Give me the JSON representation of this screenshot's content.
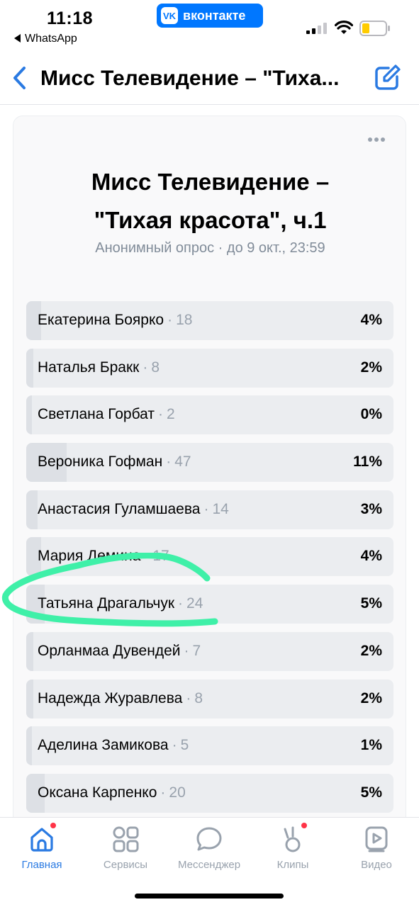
{
  "status_bar": {
    "time": "11:18",
    "back_app": "WhatsApp",
    "vk_logo": "VK",
    "vk_label": "вконтакте"
  },
  "header": {
    "title": "Мисс Телевидение – \"Тиха..."
  },
  "poll": {
    "title_line1": "Мисс Телевидение –",
    "title_line2": "\"Тихая красота\", ч.1",
    "subtitle": "Анонимный опрос · до 9 окт., 23:59",
    "options": [
      {
        "name": "Екатерина Боярко",
        "count": "18",
        "percent": "4%",
        "fill": 0.04
      },
      {
        "name": "Наталья Бракк",
        "count": "8",
        "percent": "2%",
        "fill": 0.02
      },
      {
        "name": "Светлана Горбат",
        "count": "2",
        "percent": "0%",
        "fill": 0.0
      },
      {
        "name": "Вероника Гофман",
        "count": "47",
        "percent": "11%",
        "fill": 0.11
      },
      {
        "name": "Анастасия Гуламшаева",
        "count": "14",
        "percent": "3%",
        "fill": 0.03
      },
      {
        "name": "Мария Демина",
        "count": "17",
        "percent": "4%",
        "fill": 0.04
      },
      {
        "name": "Татьяна Драгальчук",
        "count": "24",
        "percent": "5%",
        "fill": 0.05
      },
      {
        "name": "Орланмаа Дувендей",
        "count": "7",
        "percent": "2%",
        "fill": 0.02
      },
      {
        "name": "Надежда Журавлева",
        "count": "8",
        "percent": "2%",
        "fill": 0.02
      },
      {
        "name": "Аделина Замикова",
        "count": "5",
        "percent": "1%",
        "fill": 0.01
      },
      {
        "name": "Оксана Карпенко",
        "count": "20",
        "percent": "5%",
        "fill": 0.05
      }
    ]
  },
  "bottom_nav": {
    "items": [
      {
        "label": "Главная",
        "icon": "home-icon",
        "active": true,
        "badge": true
      },
      {
        "label": "Сервисы",
        "icon": "services-icon",
        "active": false,
        "badge": false
      },
      {
        "label": "Мессенджер",
        "icon": "messenger-icon",
        "active": false,
        "badge": false
      },
      {
        "label": "Клипы",
        "icon": "clips-icon",
        "active": false,
        "badge": true
      },
      {
        "label": "Видео",
        "icon": "video-icon",
        "active": false,
        "badge": false
      }
    ]
  },
  "colors": {
    "accent": "#2a7ae2",
    "vk_brand": "#0077ff",
    "scribble": "#3ff0a8",
    "badge": "#ff3347"
  }
}
